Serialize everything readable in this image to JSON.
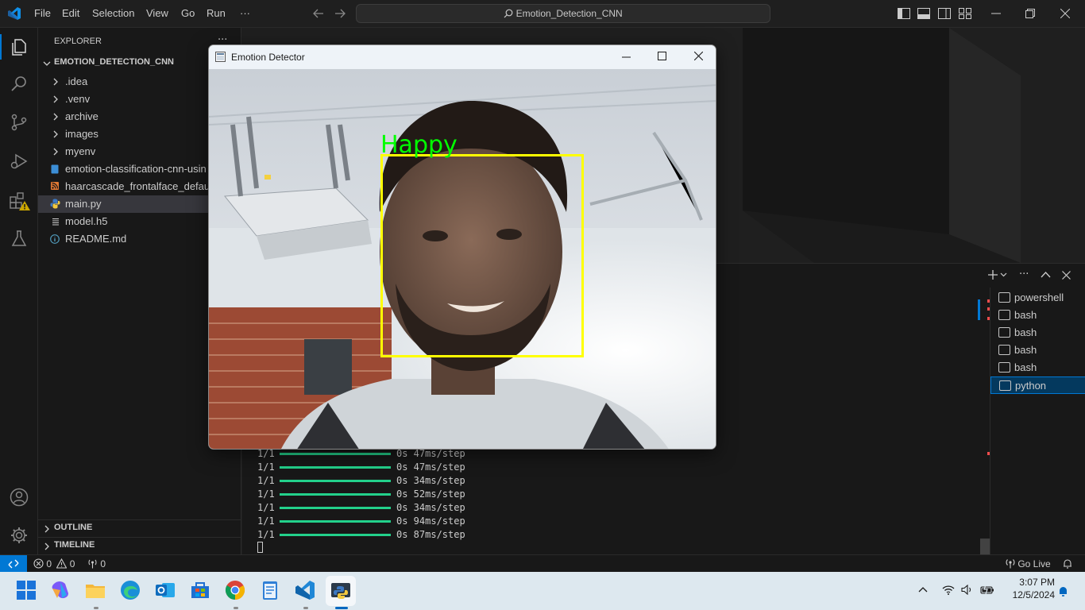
{
  "vscode": {
    "menu": [
      "File",
      "Edit",
      "Selection",
      "View",
      "Go",
      "Run",
      "···"
    ],
    "search_text": "Emotion_Detection_CNN",
    "explorer": {
      "header": "EXPLORER",
      "project": "EMOTION_DETECTION_CNN",
      "items": [
        {
          "label": ".idea",
          "type": "folder"
        },
        {
          "label": ".venv",
          "type": "folder"
        },
        {
          "label": "archive",
          "type": "folder"
        },
        {
          "label": "images",
          "type": "folder"
        },
        {
          "label": "myenv",
          "type": "folder"
        },
        {
          "label": "emotion-classification-cnn-usin",
          "type": "notebook"
        },
        {
          "label": "haarcascade_frontalface_defaul",
          "type": "xml"
        },
        {
          "label": "main.py",
          "type": "python",
          "selected": true
        },
        {
          "label": "model.h5",
          "type": "file"
        },
        {
          "label": "README.md",
          "type": "info"
        }
      ],
      "outline": "OUTLINE",
      "timeline": "TIMELINE"
    },
    "terminal_log": [
      {
        "step": "1/1",
        "time": "0s 47ms/step"
      },
      {
        "step": "1/1",
        "time": "0s 47ms/step"
      },
      {
        "step": "1/1",
        "time": "0s 34ms/step"
      },
      {
        "step": "1/1",
        "time": "0s 52ms/step"
      },
      {
        "step": "1/1",
        "time": "0s 34ms/step"
      },
      {
        "step": "1/1",
        "time": "0s 94ms/step"
      },
      {
        "step": "1/1",
        "time": "0s 87ms/step"
      }
    ],
    "terminals": [
      "powershell",
      "bash",
      "bash",
      "bash",
      "bash",
      "python"
    ],
    "active_terminal": "python",
    "status": {
      "errors": "0",
      "warnings": "0",
      "ports": "0",
      "go_live": "Go Live"
    }
  },
  "emotion_window": {
    "title": "Emotion Detector",
    "detected_emotion": "Happy",
    "box_color": "#ffff00",
    "label_color": "#00ff00"
  },
  "taskbar": {
    "time": "3:07 PM",
    "date": "12/5/2024",
    "apps": [
      "start",
      "copilot",
      "file-explorer",
      "edge",
      "outlook",
      "store",
      "chrome",
      "notepad",
      "vscode",
      "python"
    ]
  },
  "colors": {
    "accent": "#0078d4",
    "terminal_progress": "#23d18b"
  }
}
